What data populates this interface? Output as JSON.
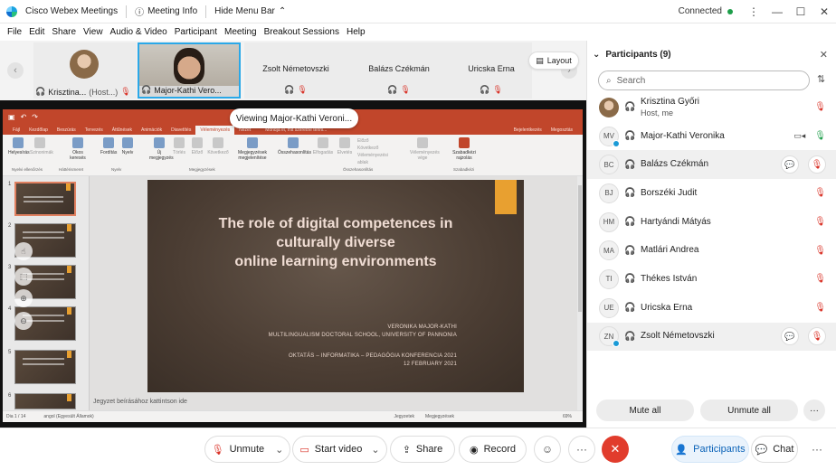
{
  "titlebar": {
    "app_name": "Cisco Webex Meetings",
    "meeting_info": "Meeting Info",
    "hide_menu": "Hide Menu Bar",
    "status": "Connected"
  },
  "menubar": [
    "File",
    "Edit",
    "Share",
    "View",
    "Audio & Video",
    "Participant",
    "Meeting",
    "Breakout Sessions",
    "Help"
  ],
  "strip": {
    "tiles": [
      {
        "name": "Krisztina...",
        "suffix": "(Host...)"
      },
      {
        "name": "Major-Kathi Vero..."
      },
      {
        "name": "Zsolt Németovszki"
      },
      {
        "name": "Balázs Czékmán"
      },
      {
        "name": "Uricska Erna"
      }
    ],
    "layout_label": "Layout"
  },
  "share": {
    "viewing_label": "Viewing Major-Kathi Veroni...",
    "ppt_tabs": [
      "Fájl",
      "Kezdőlap",
      "Beszúrás",
      "Tervezés",
      "Áttűnések",
      "Animációk",
      "Diavetítés",
      "Véleményezés",
      "Nézet"
    ],
    "ppt_tab_selected": "Véleményezés",
    "ppt_tell_me": "Mondja el, mit szeretne tenni...",
    "ppt_share_right": [
      "Bejelentkezés",
      "Megosztás"
    ],
    "ribbon": {
      "b1": "Helyesírás",
      "b2": "Szinonimák",
      "b3": "Okos keresés",
      "b4": "Fordítás",
      "b5": "Nyelv",
      "b6": "Új megjegyzés",
      "b7": "Törlés",
      "b8": "Előző",
      "b9": "Következő",
      "b10": "Megjegyzések megjelenítése",
      "b11": "Összehasonlítás",
      "b12": "Elfogadás",
      "b13": "Elvetés",
      "b14": "Előző",
      "b15": "Következő",
      "b16": "Véleményezési ablak",
      "b17": "Véleményezés vége",
      "b18": "Szabadkézi rajzolás"
    },
    "ribbon_groups": {
      "g1": "Nyelvi ellenőrzés",
      "g2": "Háttérismeret",
      "g3": "Nyelv",
      "g4": "Megjegyzések",
      "g5": "Összehasonlítás",
      "g6": "Szabadkézi"
    },
    "thumb_numbers": [
      "1",
      "2",
      "3",
      "4",
      "5",
      "6"
    ],
    "slide": {
      "title_l1": "The role of digital competences in",
      "title_l2": "culturally diverse",
      "title_l3": "online learning environments",
      "author": "VERONIKA MAJOR-KATHI",
      "school": "MULTILINGUALISM DOCTORAL SCHOOL, UNIVERSITY OF PANNONIA",
      "conference": "OKTATÁS – INFORMATIKA – PEDAGÓGIA KONFERENCIA 2021",
      "date": "12 FEBRUARY 2021"
    },
    "notes_placeholder": "Jegyzet beírásához kattintson ide",
    "status_left": "Dia 1 / 14",
    "status_lang": "angol (Egyesült Államok)",
    "status_notes": "Jegyzetek",
    "status_comments": "Megjegyzések",
    "zoom": "69%"
  },
  "participants": {
    "title": "Participants (9)",
    "search_placeholder": "Search",
    "list": [
      {
        "initials": "",
        "name": "Krisztina Győri",
        "role": "Host, me",
        "photo": true
      },
      {
        "initials": "MV",
        "name": "Major-Kathi Veronika",
        "role": ""
      },
      {
        "initials": "BC",
        "name": "Balázs Czékmán",
        "role": ""
      },
      {
        "initials": "BJ",
        "name": "Borszéki Judit",
        "role": ""
      },
      {
        "initials": "HM",
        "name": "Hartyándi Mátyás",
        "role": ""
      },
      {
        "initials": "MA",
        "name": "Matlári Andrea",
        "role": ""
      },
      {
        "initials": "TI",
        "name": "Thékes István",
        "role": ""
      },
      {
        "initials": "UE",
        "name": "Uricska Erna",
        "role": ""
      },
      {
        "initials": "ZN",
        "name": "Zsolt Németovszki",
        "role": ""
      }
    ],
    "mute_all": "Mute all",
    "unmute_all": "Unmute all"
  },
  "bottom": {
    "unmute": "Unmute",
    "start_video": "Start video",
    "share": "Share",
    "record": "Record",
    "participants": "Participants",
    "chat": "Chat"
  }
}
